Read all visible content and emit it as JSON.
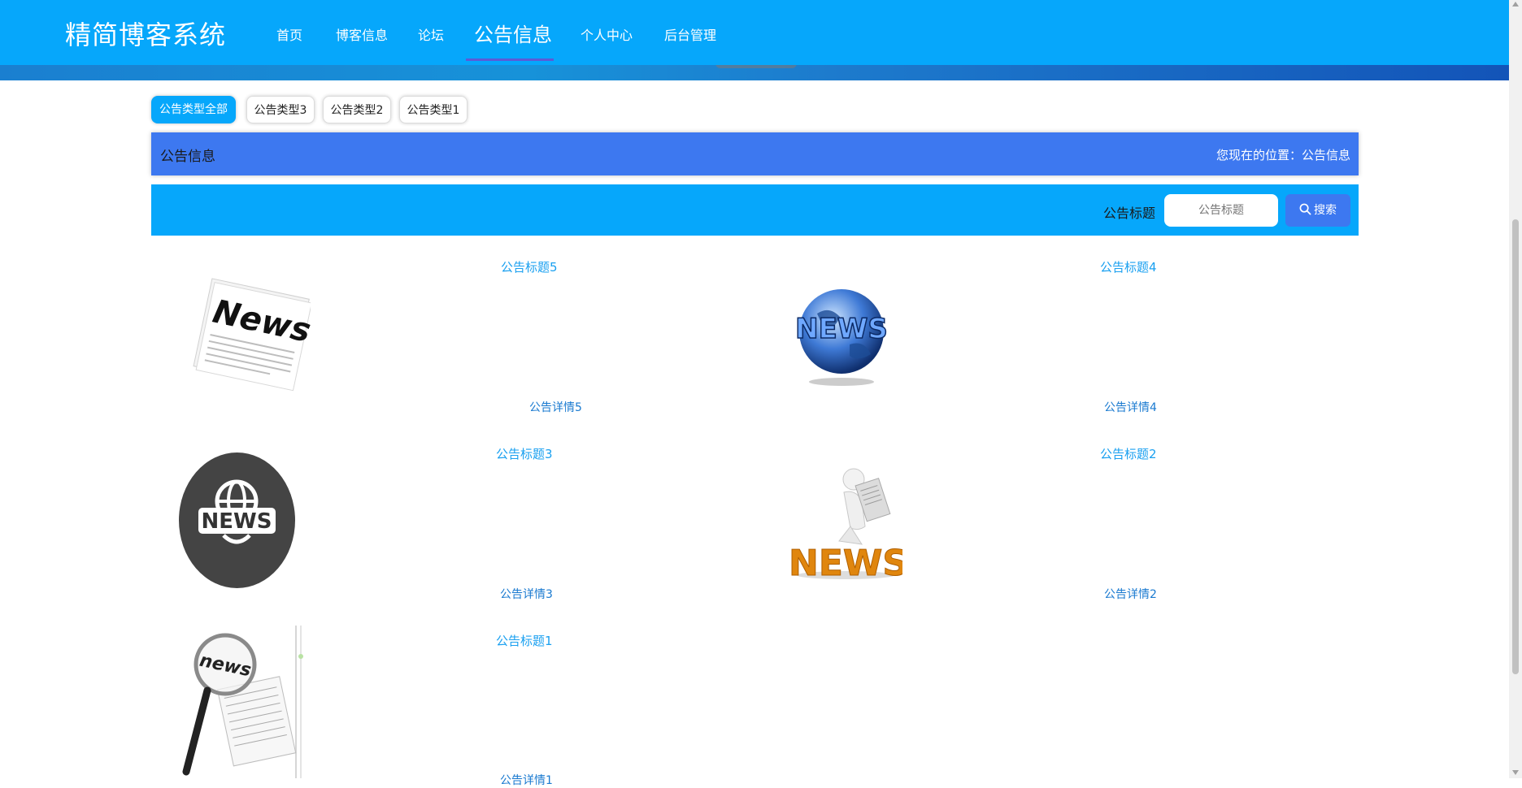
{
  "header": {
    "brand": "精简博客系统",
    "nav": [
      "首页",
      "博客信息",
      "论坛",
      "公告信息",
      "个人中心",
      "后台管理"
    ],
    "active_index": 3
  },
  "filters": [
    "公告类型全部",
    "公告类型3",
    "公告类型2",
    "公告类型1"
  ],
  "section": {
    "title": "公告信息",
    "breadcrumb": "您现在的位置：公告信息"
  },
  "search": {
    "label": "公告标题",
    "placeholder": "公告标题",
    "button": "搜索"
  },
  "cards": [
    {
      "title": "公告标题5",
      "detail": "公告详情5",
      "image": "news-newspaper-image"
    },
    {
      "title": "公告标题4",
      "detail": "公告详情4",
      "image": "news-globe-image"
    },
    {
      "title": "公告标题3",
      "detail": "公告详情3",
      "image": "news-circle-globe-image"
    },
    {
      "title": "公告标题2",
      "detail": "公告详情2",
      "image": "news-reader-figure-image"
    },
    {
      "title": "公告标题1",
      "detail": "公告详情1",
      "image": "news-magnifier-image"
    }
  ],
  "colors": {
    "header": "#06a7fb",
    "title_bar": "#3d78f0",
    "search_bar": "#06a7fb",
    "link": "#1aa0f0"
  }
}
